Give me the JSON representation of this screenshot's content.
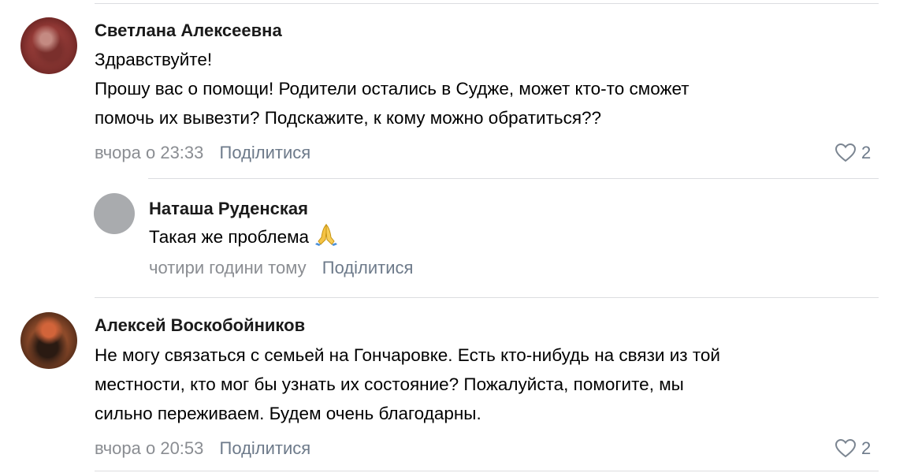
{
  "comments": [
    {
      "author": "Светлана Алексеевна",
      "lines": [
        "Здравствуйте!",
        "Прошу вас о помощи! Родители остались в Судже, может кто-то сможет",
        "помочь их вывезти? Подскажите, к кому можно обратиться??"
      ],
      "time": "вчора о 23:33",
      "share_label": "Поділитися",
      "likes": "2",
      "reply": {
        "author": "Наташа Руденская",
        "text": "Такая же проблема",
        "emoji": "praying-hands-emoji",
        "time": "чотири години тому",
        "share_label": "Поділитися"
      }
    },
    {
      "author": "Алексей Воскобойников",
      "lines": [
        "Не могу связаться с семьей на Гончаровке. Есть кто-нибудь на связи из той",
        "местности, кто мог бы узнать их состояние? Пожалуйста, помогите, мы",
        "сильно переживаем. Будем очень благодарны."
      ],
      "time": "вчора о 20:53",
      "share_label": "Поділитися",
      "likes": "2"
    }
  ],
  "colors": {
    "meta": "#8a8d92",
    "link": "#6d7a8a",
    "divider": "#dcdde0"
  }
}
